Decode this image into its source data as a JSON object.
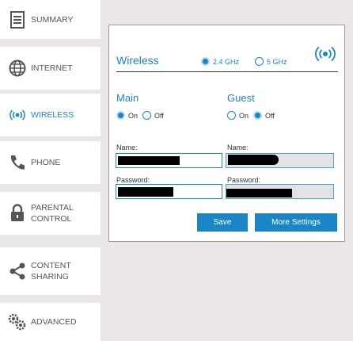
{
  "sidebar": {
    "items": [
      {
        "label": "SUMMARY",
        "icon": "summary-icon"
      },
      {
        "label": "INTERNET",
        "icon": "globe-icon"
      },
      {
        "label": "WIRELESS",
        "icon": "wireless-icon"
      },
      {
        "label": "PHONE",
        "icon": "phone-icon"
      },
      {
        "label": "PARENTAL\nCONTROL",
        "icon": "lock-icon"
      },
      {
        "label": "CONTENT\nSHARING",
        "icon": "share-icon"
      },
      {
        "label": "ADVANCED",
        "icon": "gears-icon"
      }
    ],
    "active": "WIRELESS"
  },
  "panel": {
    "title": "Wireless",
    "bands": [
      {
        "label": "2.4 GHz",
        "selected": true
      },
      {
        "label": "5 GHz",
        "selected": false
      }
    ],
    "header_icon": "wireless-icon"
  },
  "main": {
    "title": "Main",
    "on_label": "On",
    "off_label": "Off",
    "state": "On",
    "name_label": "Name:",
    "password_label": "Password:"
  },
  "guest": {
    "title": "Guest",
    "on_label": "On",
    "off_label": "Off",
    "state": "Off",
    "name_label": "Name:",
    "password_label": "Password:"
  },
  "buttons": {
    "save": "Save",
    "more_settings": "More Settings"
  },
  "colors": {
    "accent": "#1a86c8",
    "background": "#ebe6ea"
  }
}
